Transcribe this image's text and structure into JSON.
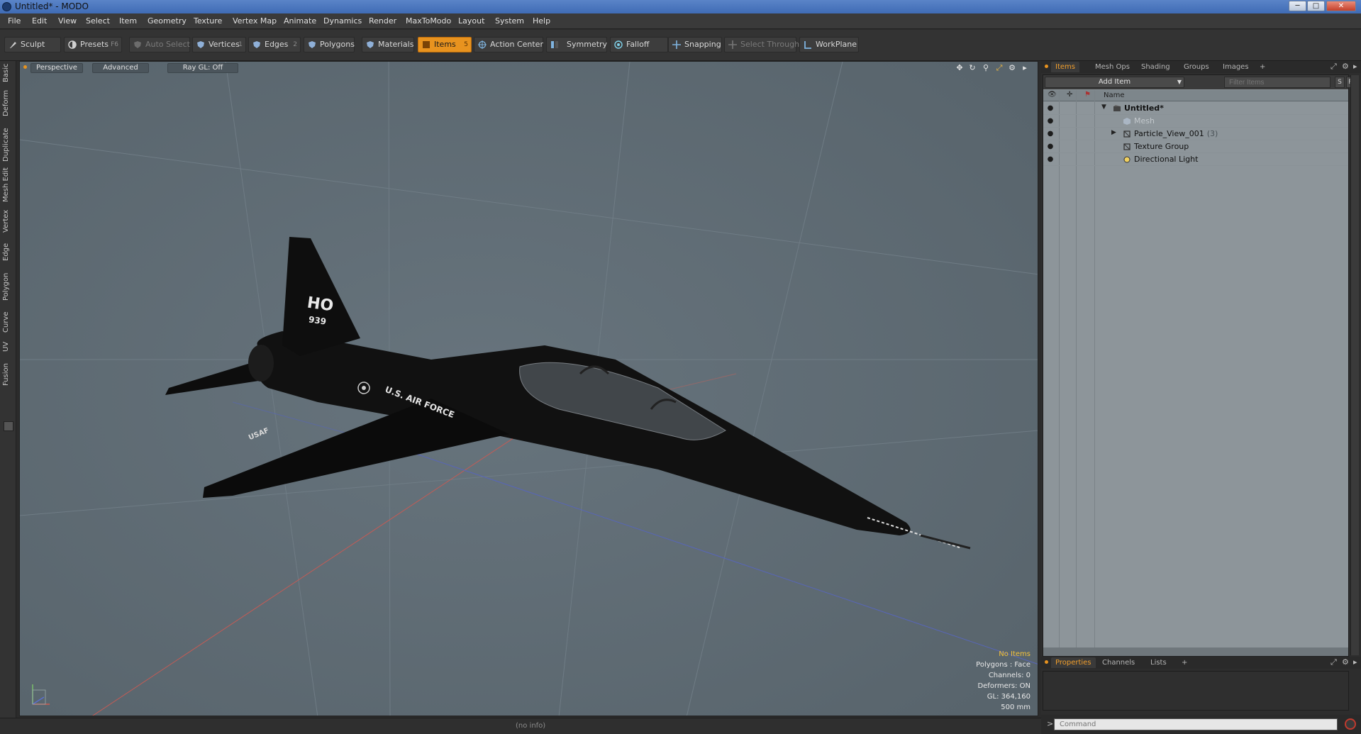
{
  "window": {
    "title": "Untitled* - MODO",
    "minimize": "─",
    "maximize": "□",
    "close": "✕"
  },
  "menu": [
    "File",
    "Edit",
    "View",
    "Select",
    "Item",
    "Geometry",
    "Texture",
    "Vertex Map",
    "Animate",
    "Dynamics",
    "Render",
    "MaxToModo",
    "Layout",
    "System",
    "Help"
  ],
  "toolbar": {
    "sculpt": "Sculpt",
    "presets": "Presets",
    "presets_key": "F6",
    "auto_select": "Auto Select",
    "vertices": "Vertices",
    "vertices_key": "1",
    "edges": "Edges",
    "edges_key": "2",
    "polygons": "Polygons",
    "materials": "Materials",
    "items": "Items",
    "items_key": "5",
    "action_center": "Action Center",
    "symmetry": "Symmetry",
    "falloff": "Falloff",
    "snapping": "Snapping",
    "select_through": "Select Through",
    "workplane": "WorkPlane"
  },
  "left_tabs": [
    "Basic",
    "Deform",
    "Duplicate",
    "Mesh Edit",
    "Vertex",
    "Edge",
    "Polygon",
    "Curve",
    "UV",
    "Fusion"
  ],
  "viewport": {
    "view": "Perspective",
    "shading": "Advanced",
    "raygl": "Ray GL: Off",
    "stats": {
      "selection": "No Items",
      "polygons": "Polygons : Face",
      "channels": "Channels: 0",
      "deformers": "Deformers: ON",
      "gl": "GL: 364,160",
      "grid": "500 mm"
    },
    "aircraft": {
      "tail_code": "HO",
      "tail_number": "939",
      "fuselage_text": "U.S. AIR FORCE",
      "wing_text": "USAF"
    }
  },
  "status": {
    "info": "(no info)"
  },
  "right_panel": {
    "tabs": [
      "Items",
      "Mesh Ops",
      "Shading",
      "Groups",
      "Images"
    ],
    "add_tab": "+",
    "add_item": "Add Item",
    "filter_placeholder": "Filter Items",
    "filter_s": "S",
    "filter_f": "F",
    "column_name": "Name",
    "tree": [
      {
        "label": "Untitled*",
        "count": ""
      },
      {
        "label": "Mesh",
        "count": ""
      },
      {
        "label": "Particle_View_001",
        "count": "(3)"
      },
      {
        "label": "Texture Group",
        "count": ""
      },
      {
        "label": "Directional Light",
        "count": ""
      }
    ],
    "bottom_tabs": [
      "Properties",
      "Channels",
      "Lists"
    ],
    "command_placeholder": "Command",
    "command_prompt": ">"
  },
  "colors": {
    "accent": "#e8931f",
    "viewport_bg": "#5e6b74",
    "tree_bg": "#8d959a"
  }
}
